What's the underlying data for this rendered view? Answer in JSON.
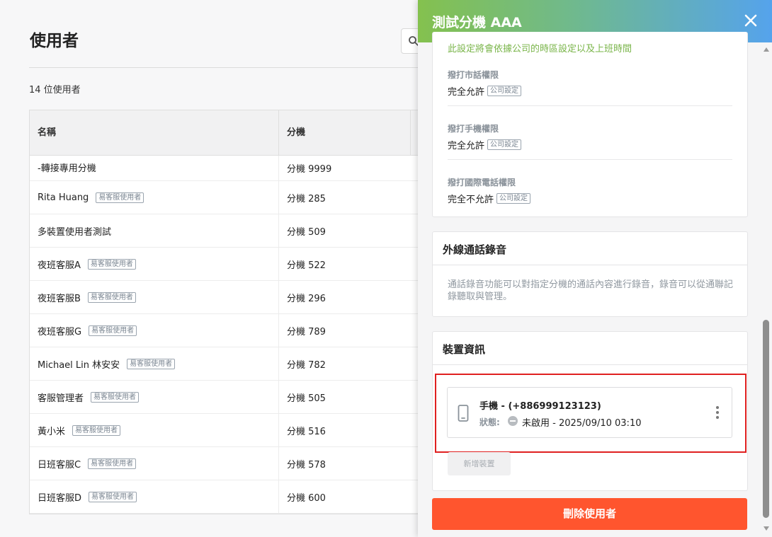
{
  "page": {
    "title": "使用者",
    "user_count": "14 位使用者"
  },
  "table": {
    "headers": {
      "name": "名稱",
      "extension": "分機"
    },
    "rows": [
      {
        "name": "-轉接專用分機",
        "badge": "",
        "extension": "分機 9999"
      },
      {
        "name": "Rita Huang",
        "badge": "易客服使用者",
        "extension": "分機 285"
      },
      {
        "name": "多裝置使用者測試",
        "badge": "",
        "extension": "分機 509"
      },
      {
        "name": "夜班客服A",
        "badge": "易客服使用者",
        "extension": "分機 522"
      },
      {
        "name": "夜班客服B",
        "badge": "易客服使用者",
        "extension": "分機 296"
      },
      {
        "name": "夜班客服G",
        "badge": "易客服使用者",
        "extension": "分機 789"
      },
      {
        "name": "Michael Lin 林安安",
        "badge": "易客服使用者",
        "extension": "分機 782"
      },
      {
        "name": "客服管理者",
        "badge": "易客服使用者",
        "extension": "分機 505"
      },
      {
        "name": "黃小米",
        "badge": "易客服使用者",
        "extension": "分機 516"
      },
      {
        "name": "日班客服C",
        "badge": "易客服使用者",
        "extension": "分機 578"
      },
      {
        "name": "日班客服D",
        "badge": "易客服使用者",
        "extension": "分機 600"
      }
    ]
  },
  "drawer": {
    "title": "測試分機 AAA",
    "close_icon": "close-icon",
    "setting_note": "此設定將會依據公司的時區設定以及上班時間",
    "permissions": [
      {
        "label": "撥打市話權限",
        "value": "完全允許",
        "badge": "公司設定"
      },
      {
        "label": "撥打手機權限",
        "value": "完全允許",
        "badge": "公司設定"
      },
      {
        "label": "撥打國際電話權限",
        "value": "完全不允許",
        "badge": "公司設定"
      }
    ],
    "recording": {
      "title": "外線通話錄音",
      "description": "通話錄音功能可以對指定分機的通話內容進行錄音，錄音可以從通聯記錄聽取與管理。"
    },
    "device_info": {
      "title": "裝置資訊",
      "device": {
        "name": "手機 - (+886999123123)",
        "status_label": "狀態:",
        "status_text": "未啟用 - 2025/09/10 03:10",
        "icon": "phone-icon"
      },
      "add_device_label": "新增裝置"
    },
    "delete_label": "刪除使用者"
  },
  "colors": {
    "accent_green": "#84c14e",
    "accent_blue": "#55a3ec",
    "danger": "#ff552e",
    "highlight": "#e02020",
    "note_green": "#7ab54a"
  }
}
